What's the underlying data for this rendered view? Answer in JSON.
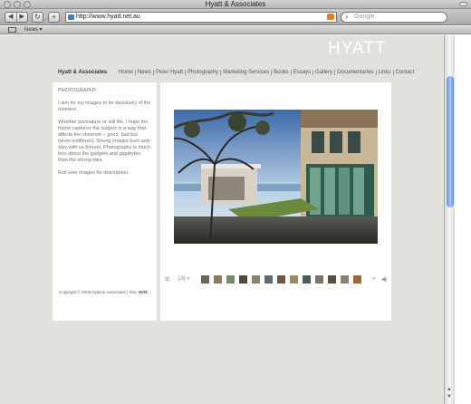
{
  "window": {
    "title": "Hyatt & Associates"
  },
  "toolbar": {
    "back": "◀",
    "forward": "▶",
    "reload": "↻",
    "add": "+",
    "url": "http://www.hyatt.net.au",
    "search_placeholder": "Google",
    "search_icon": "magnifier-icon"
  },
  "bookmarks": {
    "items": [
      "News ▾"
    ]
  },
  "site": {
    "logo": "HYATT",
    "name": "Hyatt & Associates",
    "nav": [
      "Home",
      "News",
      "Peter Hyatt",
      "Photography",
      "Marketing Services",
      "Books",
      "Essays",
      "Gallery",
      "Documentaries",
      "Links",
      "Contact"
    ]
  },
  "sidebar": {
    "heading": "PHOTOGRAPHY",
    "paragraphs": [
      "I aim for my images to be decisively of the moment.",
      "Whether portraiture or still life, I hope the frame captures the subject in a way that affects the observer – good, bad but never indifferent. Strong images burn and stay with us forever. Photography is much less about the gadgets and gigabytes than the strong idea.",
      "Roll over images for description."
    ]
  },
  "gallery": {
    "thumbnail_count": 13,
    "controls": [
      "⊞",
      "1/8",
      "«",
      "»",
      "◀)"
    ]
  },
  "footer": {
    "text": "Copyright © 2008 Hyatt & Associates | Site:",
    "credit": "AVO"
  },
  "colors": {
    "page_bg": "#e3e1db",
    "text": "#7a716a",
    "accent": "#4a7fc0"
  }
}
